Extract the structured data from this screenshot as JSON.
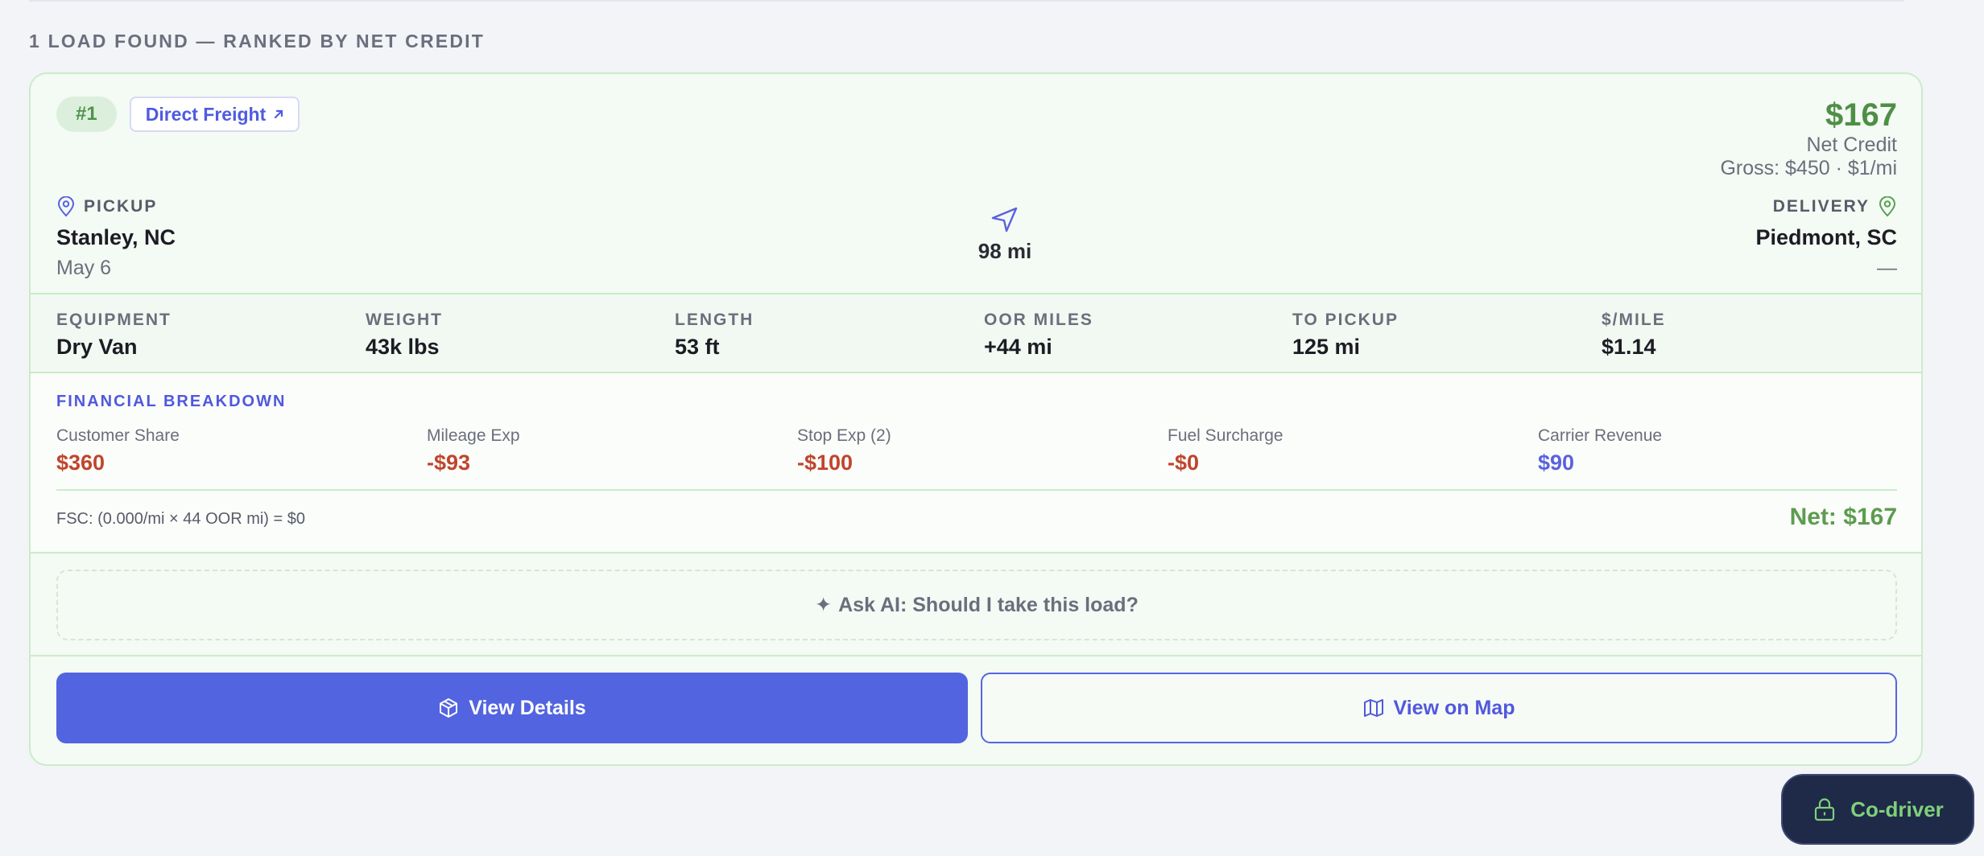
{
  "results": {
    "heading": "1 LOAD FOUND — RANKED BY NET CREDIT"
  },
  "load": {
    "rank": "#1",
    "source": "Direct Freight",
    "source_icon": "external-link-icon",
    "net_credit": "$167",
    "net_credit_label": "Net Credit",
    "gross_line": "Gross: $450 · $1/mi",
    "pickup": {
      "label": "PICKUP",
      "city": "Stanley, NC",
      "date": "May 6",
      "icon": "map-pin-icon"
    },
    "delivery": {
      "label": "DELIVERY",
      "city": "Piedmont, SC",
      "date": "—",
      "icon": "map-pin-icon"
    },
    "distance": {
      "value": "98 mi",
      "icon": "navigation-arrow-icon"
    },
    "specs": [
      {
        "label": "EQUIPMENT",
        "value": "Dry Van"
      },
      {
        "label": "WEIGHT",
        "value": "43k lbs"
      },
      {
        "label": "LENGTH",
        "value": "53 ft"
      },
      {
        "label": "OOR MILES",
        "value": "+44 mi"
      },
      {
        "label": "TO PICKUP",
        "value": "125 mi"
      },
      {
        "label": "$/MILE",
        "value": "$1.14"
      }
    ]
  },
  "financial": {
    "heading": "FINANCIAL BREAKDOWN",
    "items": [
      {
        "label": "Customer Share",
        "value": "$360",
        "color": "#c0452c"
      },
      {
        "label": "Mileage Exp",
        "value": "-$93",
        "color": "#c0452c"
      },
      {
        "label": "Stop Exp (2)",
        "value": "-$100",
        "color": "#c0452c"
      },
      {
        "label": "Fuel Surcharge",
        "value": "-$0",
        "color": "#c0452c"
      },
      {
        "label": "Carrier Revenue",
        "value": "$90",
        "color": "#5a62de"
      }
    ],
    "fsc_formula": "FSC: (0.000/mi × 44 OOR mi) = $0",
    "net_total": "Net: $167"
  },
  "ai": {
    "prompt": "Ask AI: Should I take this load?",
    "icon": "sparkle-icon"
  },
  "actions": {
    "view_details": "View Details",
    "view_details_icon": "package-icon",
    "view_on_map": "View on Map",
    "view_on_map_icon": "map-icon"
  },
  "codriver": {
    "label": "Co-driver",
    "icon": "lock-icon"
  },
  "colors": {
    "accent": "#5364e0",
    "positive": "#4e8f46",
    "negative": "#c0452c",
    "card_border": "#c9ecc9"
  }
}
